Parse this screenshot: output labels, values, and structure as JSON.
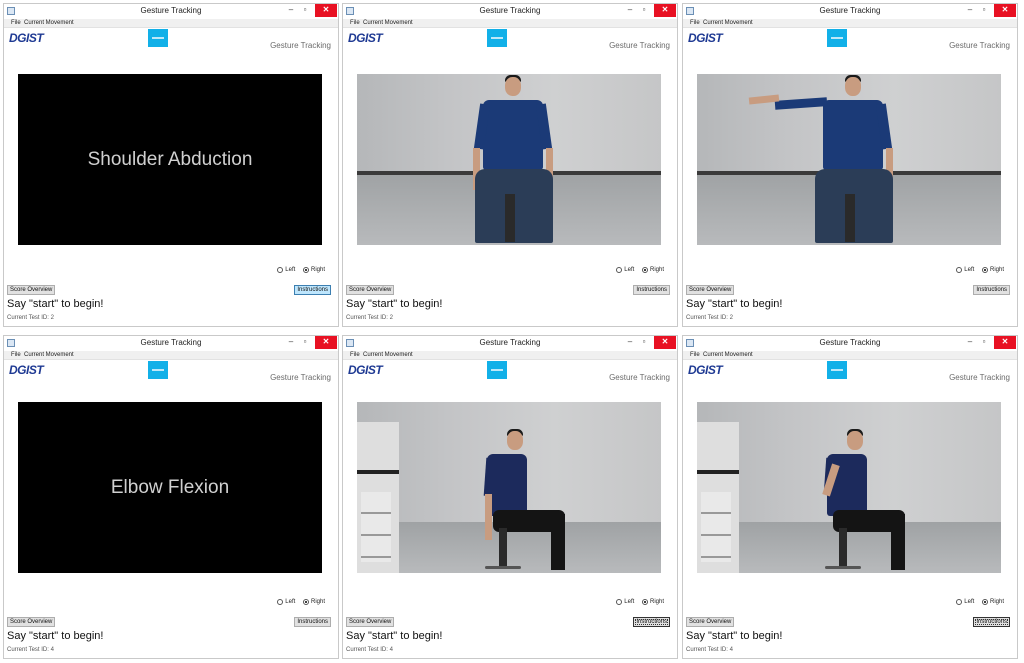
{
  "common": {
    "window_title": "Gesture Tracking",
    "menu_file": "File",
    "menu_movement": "Current Movement",
    "logo": "DGIST",
    "header": "Gesture Tracking",
    "radio_left": "Left",
    "radio_right": "Right",
    "selected_side": "Right",
    "score_overview": "Score Overview",
    "instructions": "Instructions",
    "prompt": "Say \"start\" to begin!",
    "accent_color": "#12b0e8",
    "close_color": "#e81123",
    "logo_color": "#1f3a93"
  },
  "windows": [
    {
      "slot": "top-left",
      "view": "title-card",
      "overlay_text": "Shoulder Abduction",
      "test_id": "Current Test ID: 2",
      "instructions_state": "highlighted"
    },
    {
      "slot": "top-middle",
      "view": "camera",
      "pose": "arms down, seated facing camera",
      "test_id": "Current Test ID: 2",
      "instructions_state": "normal"
    },
    {
      "slot": "top-right",
      "view": "camera",
      "pose": "right arm abducted to the side",
      "test_id": "Current Test ID: 2",
      "instructions_state": "normal"
    },
    {
      "slot": "bottom-left",
      "view": "title-card",
      "overlay_text": "Elbow Flexion",
      "test_id": "Current Test ID: 4",
      "instructions_state": "normal"
    },
    {
      "slot": "bottom-middle",
      "view": "camera",
      "pose": "seated side view, arm extended",
      "test_id": "Current Test ID: 4",
      "instructions_state": "focused"
    },
    {
      "slot": "bottom-right",
      "view": "camera",
      "pose": "seated side view, elbow flexed",
      "test_id": "Current Test ID: 4",
      "instructions_state": "focused"
    }
  ]
}
